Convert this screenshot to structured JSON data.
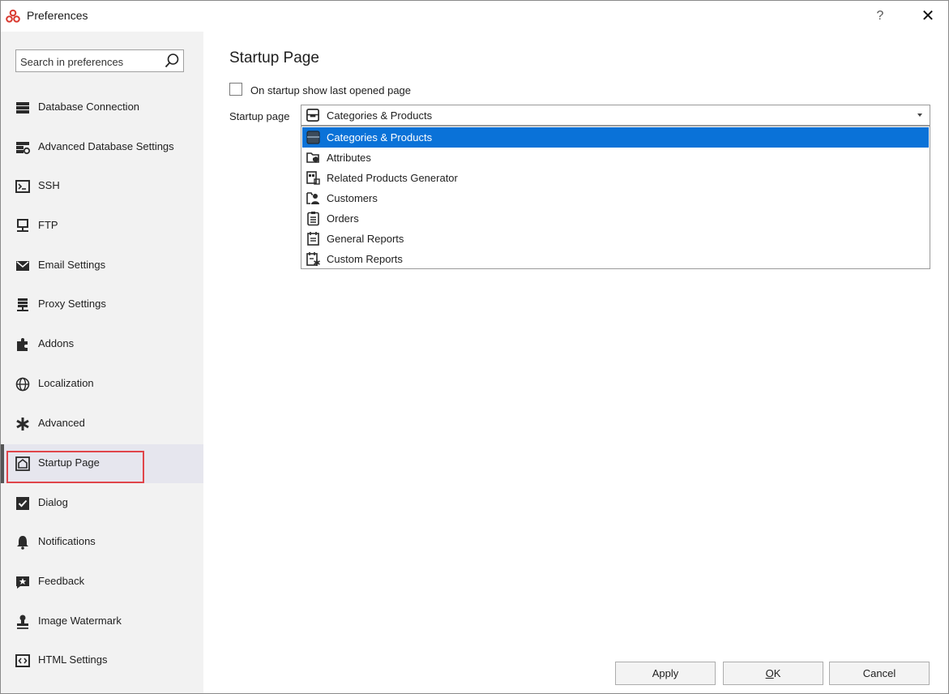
{
  "window": {
    "title": "Preferences",
    "help_label": "?",
    "close_label": "✕"
  },
  "sidebar": {
    "search": {
      "placeholder": "Search in preferences",
      "value": ""
    },
    "items": [
      {
        "label": "Database Connection",
        "icon": "database-icon"
      },
      {
        "label": "Advanced Database Settings",
        "icon": "database-settings-icon"
      },
      {
        "label": "SSH",
        "icon": "terminal-icon"
      },
      {
        "label": "FTP",
        "icon": "network-icon"
      },
      {
        "label": "Email Settings",
        "icon": "envelope-icon"
      },
      {
        "label": "Proxy Settings",
        "icon": "server-icon"
      },
      {
        "label": "Addons",
        "icon": "puzzle-icon"
      },
      {
        "label": "Localization",
        "icon": "globe-icon"
      },
      {
        "label": "Advanced",
        "icon": "asterisk-icon"
      },
      {
        "label": "Startup Page",
        "icon": "home-icon",
        "selected": true
      },
      {
        "label": "Dialog",
        "icon": "checkbox-icon"
      },
      {
        "label": "Notifications",
        "icon": "bell-icon"
      },
      {
        "label": "Feedback",
        "icon": "star-comment-icon"
      },
      {
        "label": "Image Watermark",
        "icon": "stamp-icon"
      },
      {
        "label": "HTML Settings",
        "icon": "code-icon"
      }
    ]
  },
  "main": {
    "title": "Startup Page",
    "show_last_opened": {
      "label": "On startup show last opened page",
      "checked": false
    },
    "startup_page": {
      "label": "Startup page",
      "selected": "Categories & Products",
      "options": [
        {
          "label": "Categories & Products",
          "icon": "inbox-tray-icon"
        },
        {
          "label": "Attributes",
          "icon": "folder-tag-icon"
        },
        {
          "label": "Related Products Generator",
          "icon": "generator-icon"
        },
        {
          "label": "Customers",
          "icon": "folder-user-icon"
        },
        {
          "label": "Orders",
          "icon": "clipboard-list-icon"
        },
        {
          "label": "General Reports",
          "icon": "calendar-report-icon"
        },
        {
          "label": "Custom Reports",
          "icon": "custom-report-icon"
        }
      ]
    }
  },
  "buttons": {
    "apply": "Apply",
    "ok_prefix": "",
    "ok_mnemonic": "O",
    "ok_suffix": "K",
    "cancel": "Cancel"
  },
  "colors": {
    "accent": "#0a72d8",
    "highlight_box": "#e0454a",
    "sidebar_bg": "#f2f2f2",
    "app_icon": "#d9382e"
  }
}
